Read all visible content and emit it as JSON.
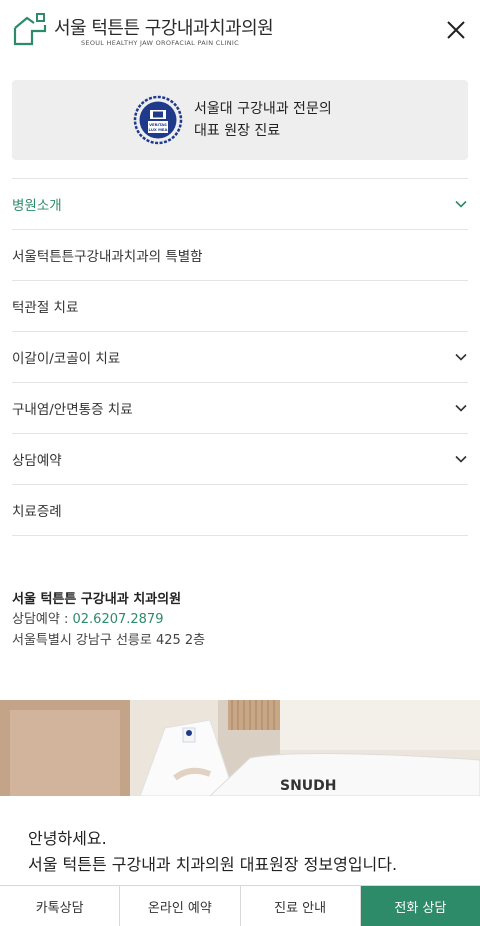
{
  "header": {
    "title": "서울 턱튼튼 구강내과치과의원",
    "subtitle": "SEOUL HEALTHY JAW OROFACIAL PAIN CLINIC"
  },
  "banner": {
    "line1": "서울대 구강내과 전문의",
    "line2": "대표 원장 진료",
    "seal_text": "VERITAS LUX MEA"
  },
  "menu": {
    "items": [
      {
        "label": "병원소개",
        "has_submenu": true,
        "active": true
      },
      {
        "label": "서울턱튼튼구강내과치과의 특별함",
        "has_submenu": false,
        "active": false
      },
      {
        "label": "턱관절 치료",
        "has_submenu": false,
        "active": false
      },
      {
        "label": "이갈이/코골이 치료",
        "has_submenu": true,
        "active": false
      },
      {
        "label": "구내염/안면통증 치료",
        "has_submenu": true,
        "active": false
      },
      {
        "label": "상담예약",
        "has_submenu": true,
        "active": false
      },
      {
        "label": "치료증례",
        "has_submenu": false,
        "active": false
      }
    ]
  },
  "info": {
    "name": "서울 턱튼튼 구강내과 치과의원",
    "phone_label": "상담예약 : ",
    "phone": "02.6207.2879",
    "address": "서울특별시 강남구 선릉로 425 2층"
  },
  "photo": {
    "sign_text": "SNUDH"
  },
  "greeting": {
    "line1": "안녕하세요.",
    "line2": "서울 턱튼튼 구강내과 치과의원 대표원장 정보영입니다."
  },
  "bottom_bar": {
    "items": [
      "카톡상담",
      "온라인 예약",
      "진료 안내",
      "전화 상담"
    ]
  },
  "colors": {
    "accent": "#2e8b6a",
    "banner_bg": "#eeeeee",
    "seal": "#1f3a8a"
  }
}
